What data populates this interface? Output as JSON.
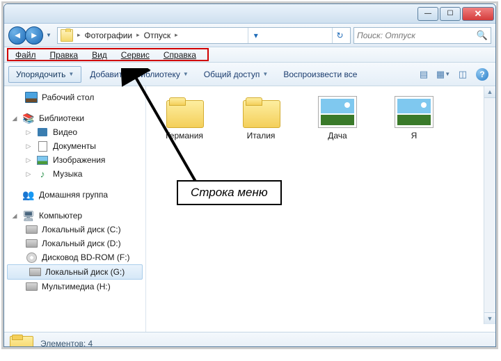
{
  "window_controls": {
    "min": "—",
    "max": "☐",
    "close": "✕"
  },
  "address": {
    "crumb1": "Фотографии",
    "crumb2": "Отпуск"
  },
  "search": {
    "placeholder": "Поиск: Отпуск"
  },
  "menubar": {
    "items": [
      "Файл",
      "Правка",
      "Вид",
      "Сервис",
      "Справка"
    ]
  },
  "commandbar": {
    "organize": "Упорядочить",
    "add_lib": "Добавить в библиотеку",
    "share": "Общий доступ",
    "play_all": "Воспроизвести все"
  },
  "sidebar": {
    "desktop": "Рабочий стол",
    "libraries": "Библиотеки",
    "video": "Видео",
    "documents": "Документы",
    "images": "Изображения",
    "music": "Музыка",
    "homegroup": "Домашняя группа",
    "computer": "Компьютер",
    "disk_c": "Локальный диск (C:)",
    "disk_d": "Локальный диск (D:)",
    "dvd_f": "Дисковод BD-ROM (F:)",
    "disk_g": "Локальный диск (G:)",
    "multi_h": "Мультимедиа (H:)"
  },
  "content": {
    "items": [
      {
        "name": "Германия",
        "type": "folder"
      },
      {
        "name": "Италия",
        "type": "folder"
      },
      {
        "name": "Дача",
        "type": "photo"
      },
      {
        "name": "Я",
        "type": "photo"
      }
    ]
  },
  "annotation": {
    "label": "Строка меню"
  },
  "statusbar": {
    "count_label": "Элементов: 4"
  }
}
